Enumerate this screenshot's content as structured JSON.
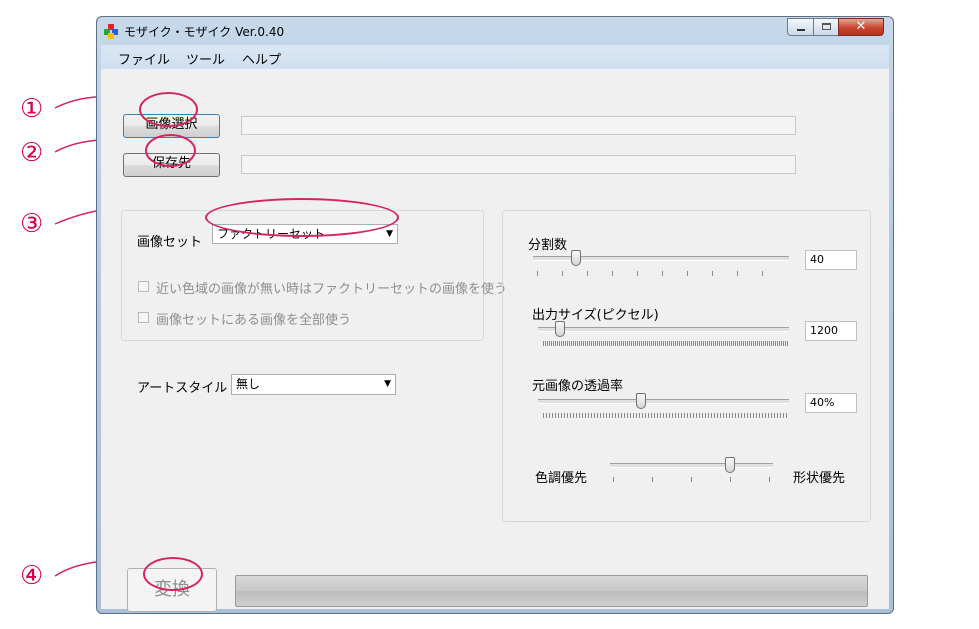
{
  "window": {
    "title": "モザイク・モザイク Ver.0.40",
    "controls": {
      "minimize": "minimize-icon",
      "maximize": "maximize-icon",
      "close": "close-icon"
    },
    "icon_colors": [
      "#e62121",
      "#1fa83a",
      "#2060e0",
      "#f0c000"
    ]
  },
  "menu": {
    "items": [
      "ファイル",
      "ツール",
      "ヘルプ"
    ]
  },
  "source": {
    "button_label": "画像選択",
    "path_value": ""
  },
  "output": {
    "button_label": "保存先",
    "path_value": ""
  },
  "image_set": {
    "label": "画像セット",
    "selected": "ファクトリーセット",
    "fallback_checkbox": {
      "label": "近い色域の画像が無い時はファクトリーセットの画像を使う",
      "checked": false,
      "enabled": false
    },
    "use_all_checkbox": {
      "label": "画像セットにある画像を全部使う",
      "checked": false,
      "enabled": false
    }
  },
  "art_style": {
    "label": "アートスタイル",
    "selected": "無し"
  },
  "sliders": {
    "divisions": {
      "label": "分割数",
      "value": "40"
    },
    "output_size": {
      "label": "出力サイズ(ピクセル)",
      "value": "1200"
    },
    "transparency": {
      "label": "元画像の透過率",
      "value": "40%"
    },
    "priority": {
      "left_label": "色調優先",
      "right_label": "形状優先"
    }
  },
  "convert": {
    "button_label": "変換",
    "enabled": false,
    "progress": 0
  },
  "annotations": {
    "markers": [
      "①",
      "②",
      "③",
      "④"
    ],
    "color": "#d4004d"
  }
}
